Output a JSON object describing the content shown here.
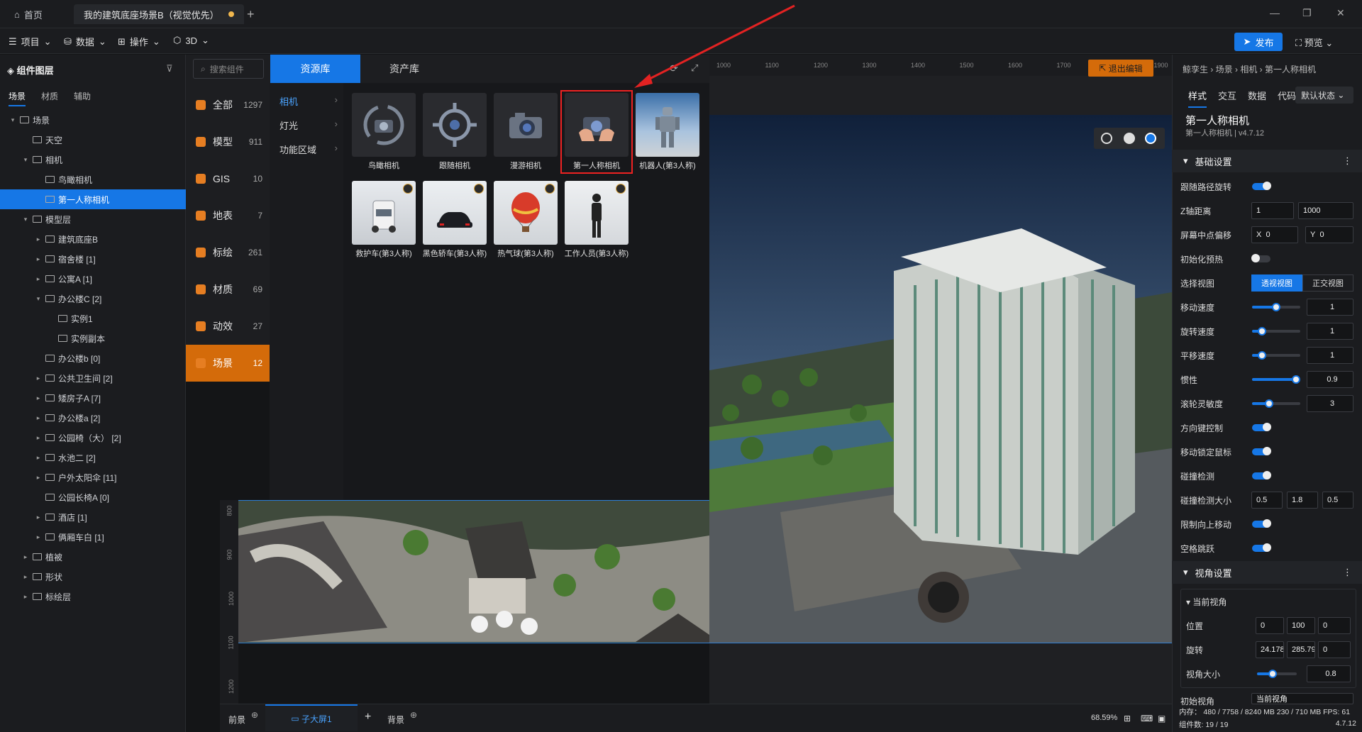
{
  "tabs": {
    "home": "首页",
    "doc": "我的建筑底座场景B（视觉优先）"
  },
  "menu": {
    "project": "项目",
    "data": "数据",
    "operate": "操作",
    "mode": "3D",
    "publish": "发布",
    "preview": "预览"
  },
  "left": {
    "title": "组件图层",
    "tabs": [
      "场景",
      "材质",
      "辅助"
    ],
    "tree": [
      {
        "label": "场景",
        "level": 0,
        "caret": "▾"
      },
      {
        "label": "天空",
        "level": 1,
        "caret": ""
      },
      {
        "label": "相机",
        "level": 1,
        "caret": "▾"
      },
      {
        "label": "鸟瞰相机",
        "level": 2,
        "caret": ""
      },
      {
        "label": "第一人称相机",
        "level": 2,
        "caret": "",
        "selected": true
      },
      {
        "label": "模型层",
        "level": 1,
        "caret": "▾"
      },
      {
        "label": "建筑底座B",
        "level": 2,
        "caret": "▸"
      },
      {
        "label": "宿舍楼 [1]",
        "level": 2,
        "caret": "▸"
      },
      {
        "label": "公寓A [1]",
        "level": 2,
        "caret": "▸"
      },
      {
        "label": "办公楼C [2]",
        "level": 2,
        "caret": "▾"
      },
      {
        "label": "实例1",
        "level": 3,
        "caret": ""
      },
      {
        "label": "实例副本",
        "level": 3,
        "caret": ""
      },
      {
        "label": "办公楼b [0]",
        "level": 2,
        "caret": ""
      },
      {
        "label": "公共卫生间 [2]",
        "level": 2,
        "caret": "▸"
      },
      {
        "label": "矮房子A [7]",
        "level": 2,
        "caret": "▸"
      },
      {
        "label": "办公楼a [2]",
        "level": 2,
        "caret": "▸"
      },
      {
        "label": "公园椅（大） [2]",
        "level": 2,
        "caret": "▸"
      },
      {
        "label": "水池二 [2]",
        "level": 2,
        "caret": "▸"
      },
      {
        "label": "户外太阳伞 [11]",
        "level": 2,
        "caret": "▸"
      },
      {
        "label": "公园长椅A [0]",
        "level": 2,
        "caret": ""
      },
      {
        "label": "酒店 [1]",
        "level": 2,
        "caret": "▸"
      },
      {
        "label": "俩厢车白 [1]",
        "level": 2,
        "caret": "▸"
      },
      {
        "label": "植被",
        "level": 1,
        "caret": "▸"
      },
      {
        "label": "形状",
        "level": 1,
        "caret": "▸"
      },
      {
        "label": "标绘层",
        "level": 1,
        "caret": "▸"
      }
    ]
  },
  "resource": {
    "search_placeholder": "搜索组件",
    "tab_res": "资源库",
    "tab_asset": "资产库",
    "categories": [
      {
        "label": "全部",
        "count": "1297"
      },
      {
        "label": "模型",
        "count": "911"
      },
      {
        "label": "GIS",
        "count": "10"
      },
      {
        "label": "地表",
        "count": "7"
      },
      {
        "label": "标绘",
        "count": "261"
      },
      {
        "label": "材质",
        "count": "69"
      },
      {
        "label": "动效",
        "count": "27"
      },
      {
        "label": "场景",
        "count": "12"
      }
    ],
    "subcats": [
      "相机",
      "灯光",
      "功能区域"
    ],
    "items": [
      {
        "label": "鸟瞰相机"
      },
      {
        "label": "跟随相机"
      },
      {
        "label": "漫游相机"
      },
      {
        "label": "第一人称相机"
      },
      {
        "label": "机器人(第3人称)"
      },
      {
        "label": "救护车(第3人称)"
      },
      {
        "label": "黑色轿车(第3人称)"
      },
      {
        "label": "热气球(第3人称)"
      },
      {
        "label": "工作人员(第3人称)"
      }
    ]
  },
  "viewport": {
    "ruler_ticks": [
      "1000",
      "1100",
      "1200",
      "1300",
      "1400",
      "1500",
      "1600",
      "1700",
      "1800",
      "1900"
    ],
    "vruler_ticks": [
      "800",
      "900",
      "1000",
      "1100",
      "1200"
    ],
    "exit_edit": "退出编辑",
    "front": "前景",
    "child_screen": "子大屏1",
    "background": "背景",
    "zoom": "68.59%"
  },
  "right": {
    "breadcrumb": "鲸孪生 › 场景 › 相机 › 第一人称相机",
    "tabs": [
      "样式",
      "交互",
      "数据",
      "代码"
    ],
    "state": "默认状态",
    "name": "第一人称相机",
    "subtitle": "第一人称相机 | v4.7.12",
    "basic_title": "基础设置",
    "follow_rotate": "跟随路径旋转",
    "z_dist": "Z轴距离",
    "z_min": "1",
    "z_max": "1000",
    "screen_offset": "屏幕中点偏移",
    "offset_x": "0",
    "offset_y": "0",
    "init_preload": "初始化预热",
    "select_view": "选择视图",
    "view_persp": "透视视图",
    "view_ortho": "正交视图",
    "move_speed": "移动速度",
    "move_speed_v": "1",
    "rot_speed": "旋转速度",
    "rot_speed_v": "1",
    "pan_speed": "平移速度",
    "pan_speed_v": "1",
    "inertia": "惯性",
    "inertia_v": "0.9",
    "wheel": "滚轮灵敏度",
    "wheel_v": "3",
    "dir_key": "方向键控制",
    "lock_mouse": "移动锁定鼠标",
    "collision": "碰撞检测",
    "collision_size": "碰撞检测大小",
    "cs_x": "0.5",
    "cs_y": "1.8",
    "cs_z": "0.5",
    "limit_up": "限制向上移动",
    "space_jump": "空格跳跃",
    "view_title": "视角设置",
    "cur_view": "当前视角",
    "pos": "位置",
    "pos_x": "0",
    "pos_y": "100",
    "pos_z": "0",
    "rot": "旋转",
    "rot_x": "24.178",
    "rot_y": "285.79",
    "rot_z": "0",
    "fov": "视角大小",
    "fov_v": "0.8",
    "init_view": "初始视角",
    "init_view_v": "当前视角"
  },
  "status": {
    "mem": "内存： 480 / 7758 / 8240 MB   230 / 710 MB   FPS: 61",
    "count": "组件数: 19 / 19",
    "version": "4.7.12"
  },
  "colors": {
    "accent": "#1677e6",
    "orange": "#d46b0a",
    "highlight": "#e22222"
  }
}
